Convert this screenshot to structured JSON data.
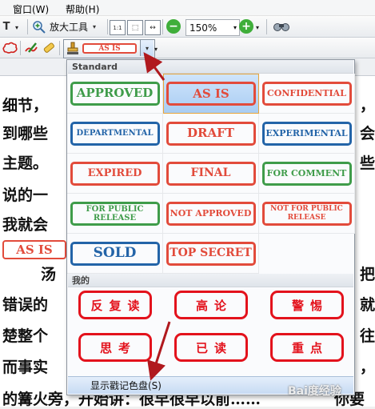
{
  "menu": {
    "window_label": "窗口(W)",
    "help_label": "帮助(H)"
  },
  "toolbar": {
    "zoom_tool_label": "放大工具",
    "zoom_level": "150%",
    "current_stamp": "AS IS"
  },
  "document": {
    "lines": [
      {
        "text": "细节，",
        "tail": "，"
      },
      {
        "text": "到哪些",
        "tail": "会"
      },
      {
        "text": "主题。",
        "tail": "些"
      },
      {
        "text": "说的一",
        "tail": ""
      },
      {
        "text": "我就会",
        "tail": ""
      },
      {
        "text": "汤",
        "tail": "把"
      },
      {
        "text": "错误的",
        "tail": "就"
      },
      {
        "text": "楚整个",
        "tail": "往"
      },
      {
        "text": "而事实",
        "tail": "，"
      },
      {
        "text": "的篝火旁，开始讲：很早很早以前……",
        "tail": "你要"
      }
    ],
    "placed_stamp": "AS IS"
  },
  "stamp_palette": {
    "standard_header": "Standard",
    "standard_stamps": [
      {
        "label": "APPROVED",
        "color": "#3f9c4a"
      },
      {
        "label": "AS IS",
        "color": "#e24b3b"
      },
      {
        "label": "CONFIDENTIAL",
        "color": "#e24b3b"
      },
      {
        "label": "DEPARTMENTAL",
        "color": "#2364a8"
      },
      {
        "label": "DRAFT",
        "color": "#e24b3b"
      },
      {
        "label": "EXPERIMENTAL",
        "color": "#2364a8"
      },
      {
        "label": "EXPIRED",
        "color": "#e24b3b"
      },
      {
        "label": "FINAL",
        "color": "#e24b3b"
      },
      {
        "label": "FOR COMMENT",
        "color": "#3f9c4a"
      },
      {
        "label": "FOR PUBLIC RELEASE",
        "color": "#3f9c4a"
      },
      {
        "label": "NOT APPROVED",
        "color": "#e24b3b"
      },
      {
        "label": "NOT FOR PUBLIC RELEASE",
        "color": "#e24b3b"
      },
      {
        "label": "SOLD",
        "color": "#2364a8"
      },
      {
        "label": "TOP SECRET",
        "color": "#e24b3b"
      }
    ],
    "my_header": "我的",
    "my_stamps": [
      {
        "label": "反复读"
      },
      {
        "label": "高论"
      },
      {
        "label": "警惕"
      },
      {
        "label": "思考"
      },
      {
        "label": "已读"
      },
      {
        "label": "重点"
      }
    ],
    "footer_label": "显示戳记色盘(S)"
  },
  "colors": {
    "stamp_red": "#e3121c",
    "arrow": "#b0191e"
  }
}
